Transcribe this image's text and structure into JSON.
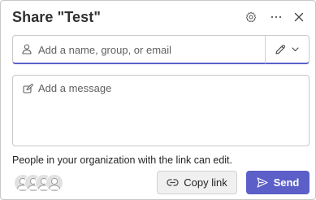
{
  "dialog": {
    "title": "Share \"Test\"",
    "settings_icon": "gear-icon",
    "more_icon": "more-horizontal-icon",
    "close_icon": "close-icon"
  },
  "recipients": {
    "placeholder": "Add a name, group, or email",
    "value": "",
    "icon": "person-icon",
    "permission_icon": "pencil-icon",
    "dropdown_icon": "chevron-down-icon"
  },
  "message": {
    "placeholder": "Add a message",
    "value": "",
    "icon": "compose-icon"
  },
  "link_info": "People in your organization with the link can edit.",
  "actions": {
    "copy_link_label": "Copy link",
    "copy_link_icon": "link-icon",
    "send_label": "Send",
    "send_icon": "send-icon"
  },
  "colors": {
    "accent": "#5b5fc7",
    "border": "#c8c8c8",
    "secondary_button_bg": "#f0f0f0"
  }
}
